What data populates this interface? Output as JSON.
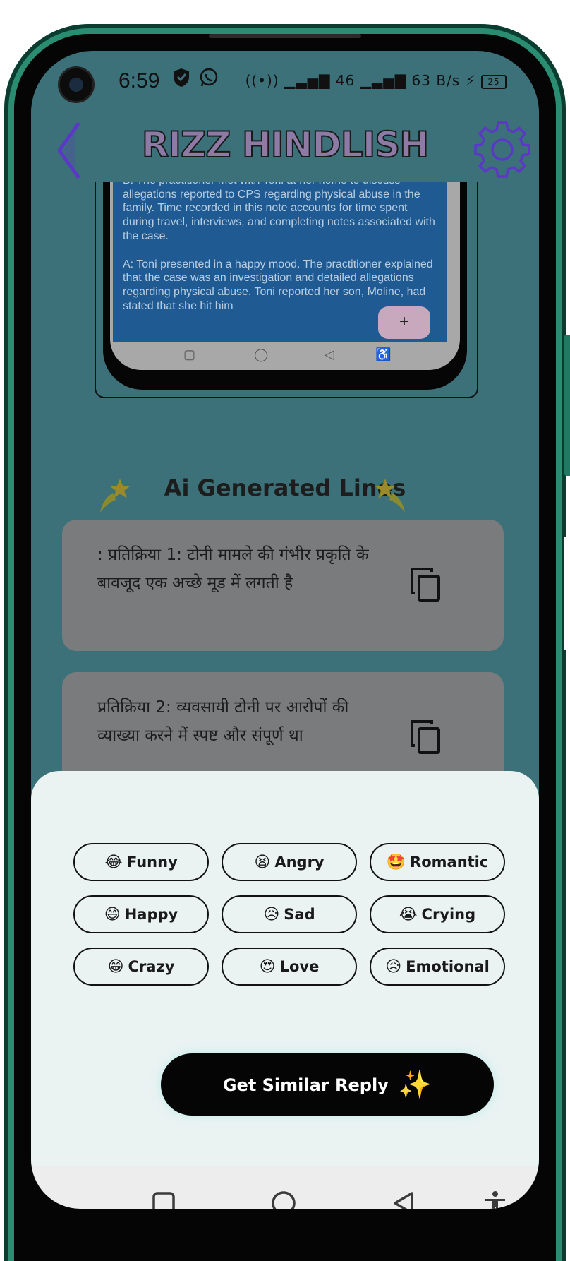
{
  "status_bar": {
    "time": "6:59",
    "right_text": "((•)) ▁▃▅▇ 46 ▁▃▅▇ 63 B/s",
    "battery": "25",
    "icons": [
      "shield-icon",
      "whatsapp-icon",
      "hotspot-icon",
      "signal-icon",
      "charging-icon",
      "battery-icon"
    ]
  },
  "header": {
    "title": "RIZZ  HINDLISH",
    "back_icon": "chevron-left-icon",
    "settings_icon": "gear-icon"
  },
  "screenshot_preview": {
    "paragraph1": "B: The practitioner met with Toni at her home to discuss allegations reported to CPS regarding physical abuse in the family. Time recorded in this note accounts for time spent during travel, interviews, and completing notes associated with the case.",
    "paragraph2": "A: Toni presented in a happy mood. The practitioner explained that the case was an investigation and detailed allegations regarding physical abuse. Toni reported her son, Moline, had stated that she hit him",
    "fab": "+"
  },
  "section": {
    "title": "Ai Generated Lines"
  },
  "replies": [
    {
      "text": ": प्रतिक्रिया 1: टोनी मामले की गंभीर प्रकृति के बावजूद एक अच्छे मूड में लगती है"
    },
    {
      "text": "प्रतिक्रिया 2: व्यवसायी टोनी पर आरोपों की व्याख्या करने में स्पष्ट और संपूर्ण था"
    }
  ],
  "moods": [
    {
      "emoji": "😂",
      "label": "Funny"
    },
    {
      "emoji": "😫",
      "label": "Angry"
    },
    {
      "emoji": "🤩",
      "label": "Romantic"
    },
    {
      "emoji": "😄",
      "label": "Happy"
    },
    {
      "emoji": "😥",
      "label": "Sad"
    },
    {
      "emoji": "😭",
      "label": "Crying"
    },
    {
      "emoji": "😁",
      "label": "Crazy"
    },
    {
      "emoji": "😍",
      "label": "Love"
    },
    {
      "emoji": "😥",
      "label": "Emotional"
    }
  ],
  "cta": {
    "label": "Get Similar Reply",
    "icon": "✨"
  },
  "colors": {
    "background": "#3c7179",
    "card": "#7a7b7c",
    "sheet": "#eaf3f2",
    "title": "#8d7ba6",
    "accent_icon": "#5b39c6"
  }
}
